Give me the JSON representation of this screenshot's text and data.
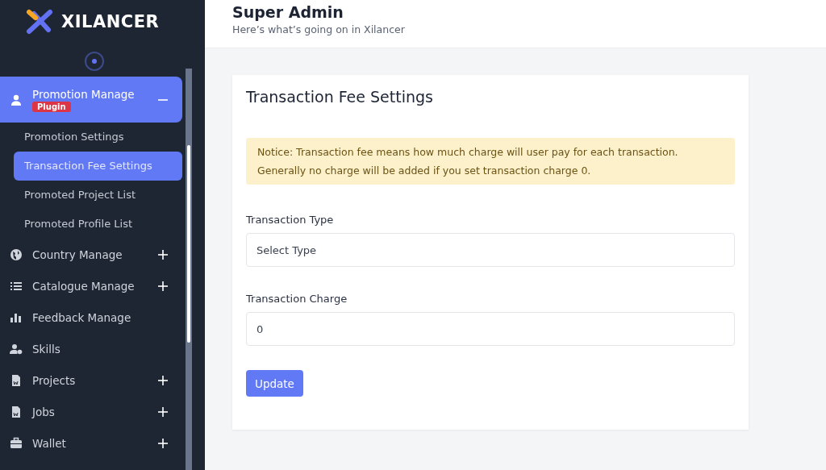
{
  "brand": {
    "name": "XILANCER"
  },
  "sidebar": {
    "items": [
      {
        "label": "Promotion Manage",
        "badge": "Plugin",
        "kind": "user",
        "expandable": true,
        "expanded": true,
        "children": [
          {
            "label": "Promotion Settings",
            "selected": false
          },
          {
            "label": "Transaction Fee Settings",
            "selected": true
          },
          {
            "label": "Promoted Project List",
            "selected": false
          },
          {
            "label": "Promoted Profile List",
            "selected": false
          }
        ]
      },
      {
        "label": "Country Manage",
        "kind": "globe",
        "expandable": true,
        "expanded": false
      },
      {
        "label": "Catalogue Manage",
        "kind": "list",
        "expandable": true,
        "expanded": false
      },
      {
        "label": "Feedback Manage",
        "kind": "bars",
        "expandable": false,
        "expanded": false
      },
      {
        "label": "Skills",
        "kind": "usergear",
        "expandable": false,
        "expanded": false
      },
      {
        "label": "Projects",
        "kind": "doc",
        "expandable": true,
        "expanded": false
      },
      {
        "label": "Jobs",
        "kind": "doc",
        "expandable": true,
        "expanded": false
      },
      {
        "label": "Wallet",
        "kind": "briefcase",
        "expandable": true,
        "expanded": false
      }
    ]
  },
  "header": {
    "title": "Super Admin",
    "subtitle": "Here’s what’s going on in Xilancer"
  },
  "card": {
    "title": "Transaction Fee Settings",
    "notice": "Notice: Transaction fee means how much charge will user pay for each transaction. Generally no charge will be added if you set transaction charge 0.",
    "fields": [
      {
        "label": "Transaction Type",
        "kind": "select",
        "placeholder": "Select Type"
      },
      {
        "label": "Transaction Charge",
        "kind": "input",
        "value": "0"
      }
    ],
    "button": "Update"
  }
}
